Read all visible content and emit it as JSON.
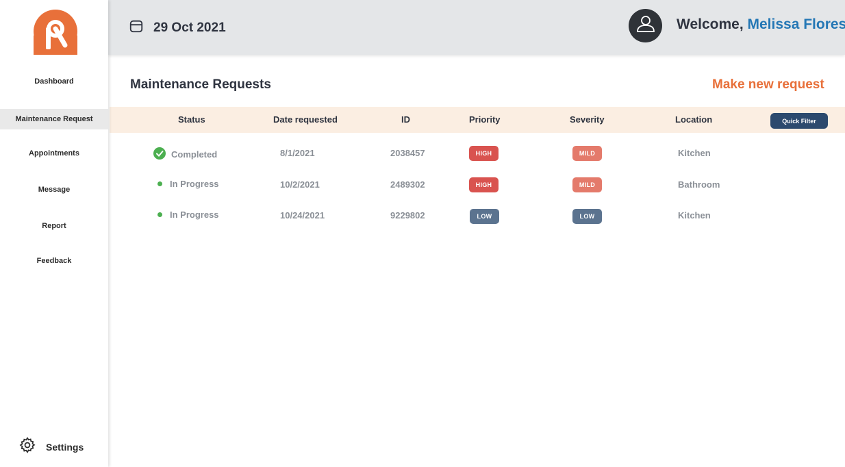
{
  "sidebar": {
    "items": [
      {
        "label": "Dashboard"
      },
      {
        "label": "Maintenance Request"
      },
      {
        "label": "Appointments"
      },
      {
        "label": "Message"
      },
      {
        "label": "Report"
      },
      {
        "label": "Feedback"
      }
    ],
    "active_index": 1,
    "settings_label": "Settings",
    "logo_color": "#e8703a"
  },
  "header": {
    "date": "29 Oct 2021",
    "welcome_prefix": "Welcome,",
    "user_name": "Melissa Flores"
  },
  "main": {
    "title": "Maintenance Requests",
    "new_request_label": "Make new request",
    "quick_filter_label": "Quick Filter",
    "columns": [
      "Status",
      "Date requested",
      "ID",
      "Priority",
      "Severity",
      "Location"
    ],
    "rows": [
      {
        "status": "Completed",
        "status_type": "completed",
        "date": "8/1/2021",
        "id": "2038457",
        "priority": "HIGH",
        "severity": "MILD",
        "location": "Kitchen"
      },
      {
        "status": "In Progress",
        "status_type": "in-progress",
        "date": "10/2/2021",
        "id": "2489302",
        "priority": "HIGH",
        "severity": "MILD",
        "location": "Bathroom"
      },
      {
        "status": "In Progress",
        "status_type": "in-progress",
        "date": "10/24/2021",
        "id": "9229802",
        "priority": "LOW",
        "severity": "LOW",
        "location": "Kitchen"
      }
    ]
  },
  "colors": {
    "accent": "#e8703a",
    "name": "#2477b5",
    "high": "#d9534f",
    "mild": "#e47a6b",
    "low": "#5b738f",
    "success": "#4caf50",
    "filter": "#2c4a6e"
  }
}
